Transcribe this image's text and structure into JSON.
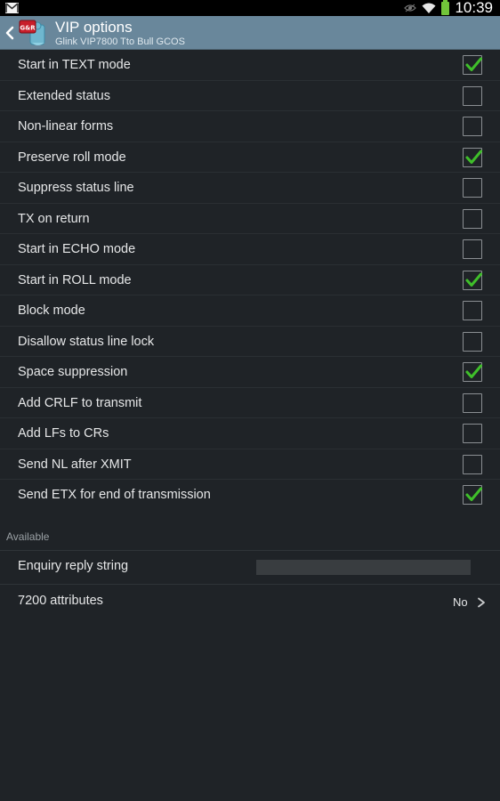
{
  "statusbar": {
    "time": "10:39",
    "icons": [
      "gmail-icon",
      "eye-icon",
      "wifi-icon",
      "battery-icon"
    ],
    "battery_color": "#72c63a"
  },
  "actionbar": {
    "title": "VIP options",
    "subtitle": "Glink VIP7800 Tto Bull GCOS",
    "background": "#69879b"
  },
  "options": [
    {
      "label": "Start in TEXT mode",
      "checked": true
    },
    {
      "label": "Extended status",
      "checked": false
    },
    {
      "label": "Non-linear forms",
      "checked": false
    },
    {
      "label": "Preserve roll mode",
      "checked": true
    },
    {
      "label": "Suppress status line",
      "checked": false
    },
    {
      "label": "TX on return",
      "checked": false
    },
    {
      "label": "Start in ECHO mode",
      "checked": false
    },
    {
      "label": "Start in ROLL mode",
      "checked": true
    },
    {
      "label": "Block mode",
      "checked": false
    },
    {
      "label": "Disallow status line lock",
      "checked": false
    },
    {
      "label": "Space suppression",
      "checked": true
    },
    {
      "label": "Add CRLF to transmit",
      "checked": false
    },
    {
      "label": "Add LFs to CRs",
      "checked": false
    },
    {
      "label": "Send NL after XMIT",
      "checked": false
    },
    {
      "label": "Send ETX for end of transmission",
      "checked": true
    }
  ],
  "available": {
    "header": "Available",
    "enquiry_label": "Enquiry reply string",
    "enquiry_value": "",
    "attributes_label": "7200 attributes",
    "attributes_value": "No"
  },
  "colors": {
    "check": "#3fbf2a",
    "background": "#1f2327"
  }
}
